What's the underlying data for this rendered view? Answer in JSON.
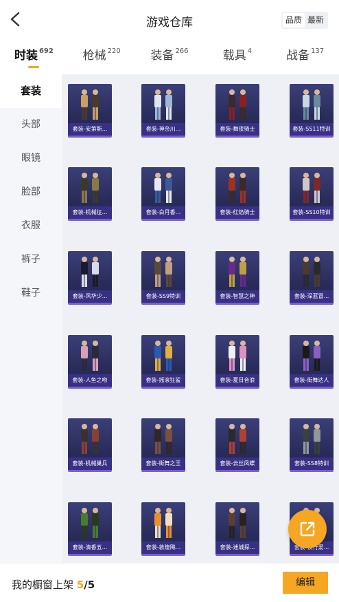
{
  "header": {
    "title": "游戏仓库",
    "sort_options": [
      "品质",
      "最新"
    ],
    "sort_selected": "品质"
  },
  "tabs": [
    {
      "label": "时装",
      "count": "692",
      "active": true
    },
    {
      "label": "枪械",
      "count": "220",
      "active": false
    },
    {
      "label": "装备",
      "count": "266",
      "active": false
    },
    {
      "label": "载具",
      "count": "4",
      "active": false
    },
    {
      "label": "战备",
      "count": "137",
      "active": false
    }
  ],
  "sidebar": {
    "items": [
      {
        "label": "套装",
        "active": true
      },
      {
        "label": "头部",
        "active": false
      },
      {
        "label": "眼镜",
        "active": false
      },
      {
        "label": "脸部",
        "active": false
      },
      {
        "label": "衣服",
        "active": false
      },
      {
        "label": "裤子",
        "active": false
      },
      {
        "label": "鞋子",
        "active": false
      }
    ]
  },
  "items": [
    {
      "label": "套装-安第斯...",
      "colors": [
        "#c8a060",
        "#4a3a2a"
      ]
    },
    {
      "label": "套装-神奈川...",
      "colors": [
        "#e0e6ef",
        "#9fb8d8"
      ]
    },
    {
      "label": "套装-舞夜骑士",
      "colors": [
        "#3a2a2a",
        "#8a2020"
      ]
    },
    {
      "label": "套装-SS11特训",
      "colors": [
        "#c8d8e0",
        "#6a8aa0"
      ]
    },
    {
      "label": "套装-机械征...",
      "colors": [
        "#3a3a2a",
        "#8a7a40"
      ]
    },
    {
      "label": "套装-白月香...",
      "colors": [
        "#e8e8f0",
        "#3a5a9a"
      ]
    },
    {
      "label": "套装-红焰骑士",
      "colors": [
        "#a03020",
        "#3a2a2a"
      ]
    },
    {
      "label": "套装-SS10特训",
      "colors": [
        "#d0c8c8",
        "#802828"
      ]
    },
    {
      "label": "套装-风华少...",
      "colors": [
        "#1a1a2a",
        "#d8dce8"
      ]
    },
    {
      "label": "套装-SS9特训",
      "colors": [
        "#5a4a3a",
        "#c0a080"
      ]
    },
    {
      "label": "套装-智慧之神",
      "colors": [
        "#6a2a8a",
        "#c0a040"
      ]
    },
    {
      "label": "套装-深蓝冒...",
      "colors": [
        "#4a3a30",
        "#2a2a2a"
      ]
    },
    {
      "label": "套装-人鱼之吻",
      "colors": [
        "#d8a0b8",
        "#2a2a3a"
      ]
    },
    {
      "label": "套装-摇滚狂鲨",
      "colors": [
        "#2a5ab0",
        "#e0b040"
      ]
    },
    {
      "label": "套装-夏日音浪",
      "colors": [
        "#f0f0f0",
        "#e090c0"
      ]
    },
    {
      "label": "套装-街舞达人",
      "colors": [
        "#1a1a1a",
        "#8a60c0"
      ]
    },
    {
      "label": "套装-机械巢兵",
      "colors": [
        "#3a3030",
        "#8a4030"
      ]
    },
    {
      "label": "套装-街舞之王",
      "colors": [
        "#302828",
        "#7a5040"
      ]
    },
    {
      "label": "套装-云丝凤蝶",
      "colors": [
        "#2a2a2a",
        "#b04030"
      ]
    },
    {
      "label": "套装-SS8特训",
      "colors": [
        "#3a4040",
        "#909898"
      ]
    },
    {
      "label": "套装-清香五...",
      "colors": [
        "#4a7a30",
        "#2a3a20"
      ]
    },
    {
      "label": "套装-敦煌飚...",
      "colors": [
        "#e89030",
        "#f0e0c0"
      ]
    },
    {
      "label": "套装-迷城探...",
      "colors": [
        "#5a4030",
        "#2a2020"
      ]
    },
    {
      "label": "套装-夜行爱...",
      "colors": [
        "#3a3a4a",
        "#6a6a7a"
      ]
    }
  ],
  "footer": {
    "shelf_label": "我的橱窗上架",
    "shelf_current": "5",
    "shelf_total": "/5",
    "edit_label": "编辑"
  },
  "colors": {
    "accent": "#f5a623",
    "card_bg": "#2a2d5c",
    "card_border": "#7b5cd6"
  },
  "icons": {
    "back": "chevron-left-icon",
    "fab": "share-external-icon"
  }
}
